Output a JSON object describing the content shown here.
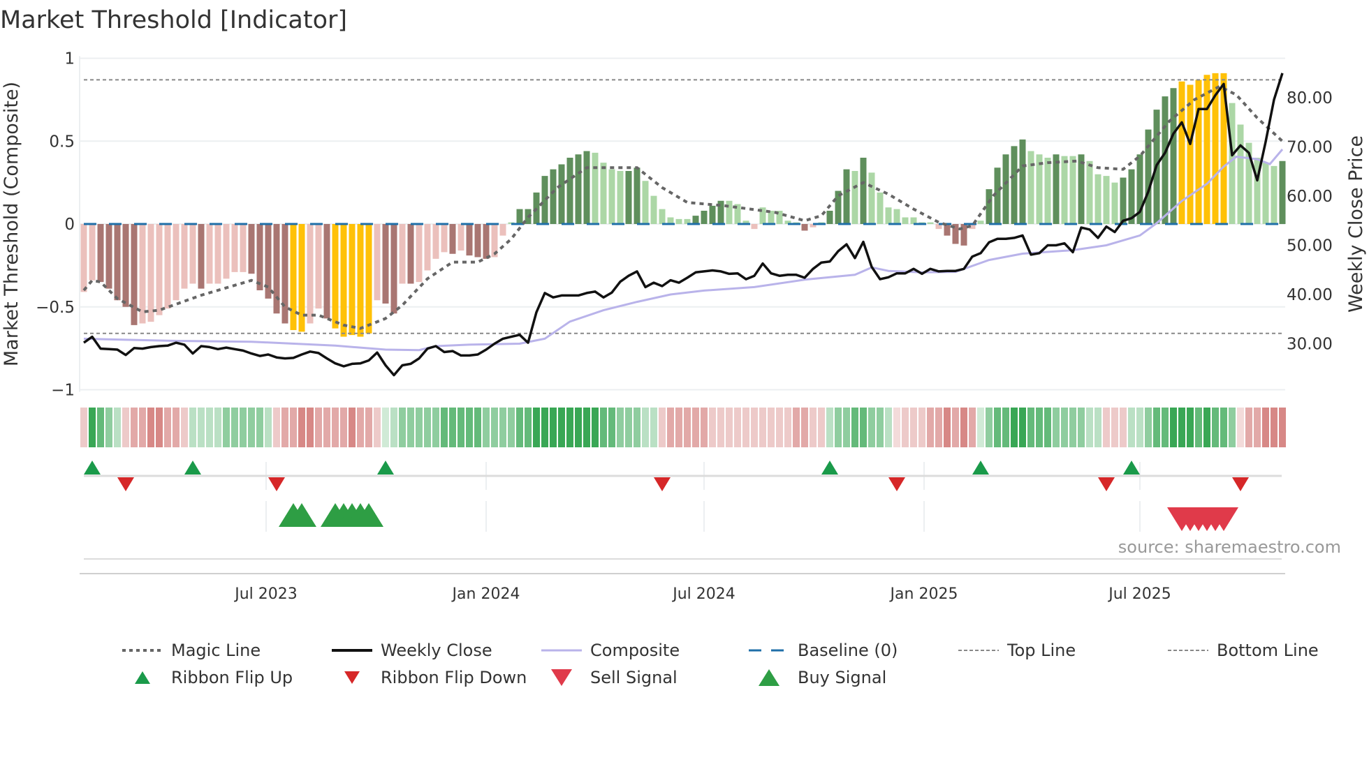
{
  "chart_data": {
    "type": "bar",
    "title": "Market Threshold [Indicator]",
    "ylabel": "Market Threshold (Composite)",
    "y2label": "Weekly Close Price",
    "source": "source: sharemaestro.com",
    "ylim": [
      -1,
      1
    ],
    "y2lim": [
      22,
      93
    ],
    "yticks": [
      {
        "v": 1,
        "label": "1"
      },
      {
        "v": 0.5,
        "label": "0.5"
      },
      {
        "v": 0,
        "label": "0"
      },
      {
        "v": -0.5,
        "label": "−0.5"
      },
      {
        "v": -1,
        "label": "−1"
      }
    ],
    "y2ticks": [
      {
        "v": 80,
        "label": "80.00"
      },
      {
        "v": 70,
        "label": "70.00"
      },
      {
        "v": 60,
        "label": "60.00"
      },
      {
        "v": 50,
        "label": "50.00"
      },
      {
        "v": 40,
        "label": "40.00"
      },
      {
        "v": 30,
        "label": "30.00"
      }
    ],
    "xticks": [
      {
        "week": 21.75,
        "label": "Jul 2023"
      },
      {
        "week": 48,
        "label": "Jan 2024"
      },
      {
        "week": 74,
        "label": "Jul 2024"
      },
      {
        "week": 100.25,
        "label": "Jan 2025"
      },
      {
        "week": 126,
        "label": "Jul 2025"
      }
    ],
    "weeks": 144,
    "top_line": 0.87,
    "bottom_line": -0.66,
    "baseline": 0,
    "composite_bars": [
      -0.41,
      -0.34,
      -0.35,
      -0.39,
      -0.46,
      -0.5,
      -0.61,
      -0.6,
      -0.59,
      -0.55,
      -0.51,
      -0.46,
      -0.39,
      -0.36,
      -0.39,
      -0.36,
      -0.36,
      -0.33,
      -0.29,
      -0.29,
      -0.3,
      -0.4,
      -0.45,
      -0.54,
      -0.6,
      -0.64,
      -0.65,
      -0.6,
      -0.51,
      -0.57,
      -0.63,
      -0.68,
      -0.67,
      -0.68,
      -0.66,
      -0.46,
      -0.48,
      -0.54,
      -0.36,
      -0.36,
      -0.35,
      -0.28,
      -0.21,
      -0.17,
      -0.18,
      -0.16,
      -0.19,
      -0.2,
      -0.21,
      -0.2,
      -0.07,
      0.01,
      0.09,
      0.09,
      0.19,
      0.29,
      0.33,
      0.36,
      0.4,
      0.42,
      0.44,
      0.43,
      0.37,
      0.33,
      0.32,
      0.32,
      0.34,
      0.26,
      0.17,
      0.09,
      0.04,
      0.03,
      0.03,
      0.05,
      0.08,
      0.11,
      0.14,
      0.14,
      0.12,
      0.02,
      -0.03,
      0.1,
      0.08,
      0.08,
      0.02,
      0.01,
      -0.04,
      -0.02,
      0.01,
      0.08,
      0.2,
      0.33,
      0.32,
      0.4,
      0.31,
      0.19,
      0.1,
      0.09,
      0.04,
      0.04,
      0.01,
      0.01,
      -0.03,
      -0.07,
      -0.12,
      -0.13,
      -0.03,
      0.02,
      0.21,
      0.34,
      0.42,
      0.47,
      0.51,
      0.44,
      0.42,
      0.4,
      0.42,
      0.41,
      0.41,
      0.42,
      0.38,
      0.3,
      0.29,
      0.25,
      0.28,
      0.33,
      0.42,
      0.57,
      0.69,
      0.77,
      0.82,
      0.86,
      0.84,
      0.87,
      0.9,
      0.91,
      0.91,
      0.73,
      0.6,
      0.49,
      0.4,
      0.37,
      0.35,
      0.38
    ],
    "bar_states": "lnlndndndndndnlnlnlnlnlnlnlndnlnlnlnlnlndndndndndnyyyylnlndnyyyyyyyylnlndndnlndnlnlnlnlndnlndndndnlnlnlnlpdpdpdpdpdpdpdpdpdpdplplplplpdpdplplplplplp",
    "bar_state_list": [
      "ln",
      "ln",
      "dn",
      "dn",
      "dn",
      "dn",
      "dn",
      "ln",
      "ln",
      "ln",
      "ln",
      "ln",
      "ln",
      "ln",
      "dn",
      "ln",
      "ln",
      "ln",
      "ln",
      "ln",
      "dn",
      "dn",
      "dn",
      "dn",
      "dn",
      "y",
      "y",
      "ln",
      "ln",
      "dn",
      "y",
      "y",
      "y",
      "y",
      "y",
      "ln",
      "dn",
      "dn",
      "ln",
      "dn",
      "ln",
      "ln",
      "ln",
      "ln",
      "dn",
      "ln",
      "dn",
      "dn",
      "dn",
      "ln",
      "ln",
      "lp",
      "dp",
      "dp",
      "dp",
      "dp",
      "dp",
      "dp",
      "dp",
      "dp",
      "dp",
      "lp",
      "lp",
      "lp",
      "lp",
      "dp",
      "dp",
      "lp",
      "lp",
      "lp",
      "lp",
      "lp",
      "lp",
      "dp",
      "dp",
      "dp",
      "dp",
      "lp",
      "lp",
      "lp",
      "ln",
      "lp",
      "lp",
      "lp",
      "lp",
      "lp",
      "dn",
      "ln",
      "lp",
      "dp",
      "dp",
      "dp",
      "lp",
      "dp",
      "lp",
      "lp",
      "lp",
      "lp",
      "lp",
      "lp",
      "lp",
      "lp",
      "ln",
      "dn",
      "dn",
      "dn",
      "ln",
      "lp",
      "dp",
      "dp",
      "dp",
      "dp",
      "dp",
      "lp",
      "lp",
      "lp",
      "dp",
      "lp",
      "lp",
      "dp",
      "lp",
      "lp",
      "lp",
      "lp",
      "dp",
      "dp",
      "dp",
      "dp",
      "dp",
      "dp",
      "dp",
      "y",
      "y",
      "y",
      "y",
      "y",
      "y",
      "lp",
      "lp",
      "lp",
      "lp",
      "lp",
      "lp",
      "dp"
    ],
    "weekly_close": [
      30.2,
      31.4,
      29.0,
      28.9,
      28.8,
      27.7,
      29.1,
      29.0,
      29.3,
      29.5,
      29.6,
      30.2,
      29.8,
      28.0,
      29.5,
      29.3,
      28.9,
      29.2,
      28.9,
      28.6,
      28.0,
      27.5,
      27.8,
      27.2,
      27.0,
      27.1,
      27.8,
      28.4,
      28.1,
      27.0,
      26.0,
      25.4,
      25.9,
      26.0,
      26.6,
      28.2,
      25.6,
      23.6,
      25.6,
      25.9,
      27.0,
      29.0,
      29.5,
      28.3,
      28.5,
      27.6,
      27.6,
      27.8,
      28.8,
      30.0,
      31.0,
      31.4,
      31.8,
      30.2,
      36.4,
      40.3,
      39.4,
      39.8,
      39.8,
      39.8,
      40.3,
      40.6,
      39.4,
      40.4,
      42.6,
      43.8,
      44.7,
      41.5,
      42.4,
      41.7,
      42.9,
      42.4,
      43.4,
      44.5,
      44.7,
      44.9,
      44.7,
      44.2,
      44.3,
      43.1,
      43.8,
      46.3,
      44.3,
      43.8,
      44.0,
      44.0,
      43.4,
      45.2,
      46.5,
      46.7,
      48.8,
      50.2,
      47.4,
      50.7,
      45.6,
      43.1,
      43.5,
      44.3,
      44.3,
      45.2,
      44.2,
      45.2,
      44.7,
      44.8,
      44.8,
      45.2,
      47.7,
      48.4,
      50.6,
      51.3,
      51.3,
      51.5,
      52.0,
      48.1,
      48.4,
      50.0,
      50.0,
      50.4,
      48.6,
      53.6,
      53.2,
      51.5,
      53.8,
      52.7,
      55.0,
      55.5,
      56.8,
      60.9,
      66.3,
      68.8,
      72.7,
      75.0,
      70.6,
      77.7,
      77.7,
      80.5,
      82.8,
      68.3,
      70.3,
      68.8,
      63.2,
      71.0,
      79.6,
      85.0
    ],
    "composite_line": [
      [
        0,
        31.0
      ],
      [
        10,
        30.6
      ],
      [
        20,
        30.4
      ],
      [
        30,
        29.6
      ],
      [
        36,
        28.8
      ],
      [
        40,
        28.7
      ],
      [
        42,
        29.5
      ],
      [
        46,
        29.8
      ],
      [
        52,
        30.0
      ],
      [
        55,
        31.0
      ],
      [
        58,
        34.5
      ],
      [
        62,
        36.8
      ],
      [
        66,
        38.5
      ],
      [
        70,
        40.0
      ],
      [
        74,
        40.8
      ],
      [
        80,
        41.5
      ],
      [
        86,
        43.0
      ],
      [
        92,
        44.0
      ],
      [
        94,
        45.5
      ],
      [
        96,
        44.8
      ],
      [
        100,
        44.5
      ],
      [
        104,
        44.6
      ],
      [
        108,
        47.0
      ],
      [
        112,
        48.3
      ],
      [
        118,
        49.0
      ],
      [
        122,
        50.0
      ],
      [
        126,
        52.0
      ],
      [
        128,
        54.5
      ],
      [
        131,
        59.0
      ],
      [
        134,
        62.5
      ],
      [
        136,
        66.0
      ],
      [
        137.5,
        68.0
      ],
      [
        140,
        67.5
      ],
      [
        141.5,
        66.5
      ],
      [
        143,
        69.5
      ]
    ],
    "magic_line": [
      [
        0,
        -0.4
      ],
      [
        1,
        -0.34
      ],
      [
        2,
        -0.35
      ],
      [
        4,
        -0.45
      ],
      [
        7,
        -0.53
      ],
      [
        9,
        -0.52
      ],
      [
        14,
        -0.43
      ],
      [
        20,
        -0.34
      ],
      [
        22,
        -0.38
      ],
      [
        24,
        -0.5
      ],
      [
        26,
        -0.55
      ],
      [
        28,
        -0.55
      ],
      [
        31,
        -0.61
      ],
      [
        33,
        -0.63
      ],
      [
        36,
        -0.57
      ],
      [
        38,
        -0.49
      ],
      [
        41,
        -0.33
      ],
      [
        44,
        -0.23
      ],
      [
        47,
        -0.23
      ],
      [
        49,
        -0.18
      ],
      [
        51,
        -0.09
      ],
      [
        53,
        0.04
      ],
      [
        56.5,
        0.22
      ],
      [
        60,
        0.34
      ],
      [
        63,
        0.34
      ],
      [
        66,
        0.34
      ],
      [
        69,
        0.22
      ],
      [
        72,
        0.13
      ],
      [
        76.5,
        0.11
      ],
      [
        79.5,
        0.09
      ],
      [
        82.5,
        0.07
      ],
      [
        86,
        0.02
      ],
      [
        88,
        0.05
      ],
      [
        90,
        0.17
      ],
      [
        93,
        0.25
      ],
      [
        96,
        0.18
      ],
      [
        99,
        0.09
      ],
      [
        102,
        0.01
      ],
      [
        104.5,
        -0.03
      ],
      [
        106,
        -0.01
      ],
      [
        108.5,
        0.17
      ],
      [
        112,
        0.35
      ],
      [
        115,
        0.37
      ],
      [
        118.5,
        0.38
      ],
      [
        121,
        0.34
      ],
      [
        124,
        0.33
      ],
      [
        126,
        0.41
      ],
      [
        129.5,
        0.62
      ],
      [
        132.5,
        0.75
      ],
      [
        135.5,
        0.83
      ],
      [
        137.5,
        0.78
      ],
      [
        140,
        0.64
      ],
      [
        143,
        0.5
      ]
    ],
    "ribbon": [
      -1,
      4,
      3,
      2,
      1,
      -1,
      -2,
      -2,
      -3,
      -3,
      -2,
      -2,
      -1,
      1,
      1,
      1,
      1,
      2,
      2,
      2,
      2,
      2,
      1,
      -1,
      -2,
      -2,
      -3,
      -3,
      -2,
      -2,
      -2,
      -2,
      -3,
      -2,
      -2,
      -1,
      0.5,
      1,
      2,
      2,
      2,
      2,
      2,
      3,
      3,
      3,
      3,
      3,
      2,
      2,
      2,
      2,
      3,
      3,
      4,
      4,
      4,
      4,
      4,
      4,
      4,
      4,
      3,
      3,
      2,
      2,
      2,
      1,
      1,
      -1,
      -2,
      -2,
      -2,
      -2,
      -2,
      -1,
      -1,
      -1,
      -1,
      -1,
      -1,
      -1,
      -1,
      -1,
      -1,
      -2,
      -2,
      -1,
      -1,
      1,
      2,
      2,
      3,
      3,
      2,
      2,
      1,
      -0.5,
      -1,
      -1,
      -1,
      -2,
      -2,
      -3,
      -2,
      -3,
      -2,
      0.5,
      2,
      3,
      3,
      4,
      4,
      3,
      3,
      3,
      2,
      2,
      2,
      2,
      1,
      1,
      -1,
      -1,
      -1,
      1,
      1,
      2,
      3,
      3,
      4,
      4,
      4,
      3,
      4,
      3,
      3,
      2,
      -0.5,
      -2,
      -2,
      -3,
      -3,
      -3
    ],
    "ribbon_flip_up": [
      1,
      13,
      36,
      89,
      107,
      125
    ],
    "ribbon_flip_down": [
      5,
      23,
      69,
      97,
      122,
      138
    ],
    "buy_signal": [
      25,
      26,
      30,
      31,
      32,
      33,
      34
    ],
    "sell_signal": [
      131,
      132,
      133,
      134,
      135,
      136
    ],
    "legend": [
      {
        "label": "Magic Line",
        "kind": "dotted",
        "color": "#666666"
      },
      {
        "label": "Weekly Close",
        "kind": "line",
        "color": "#111111"
      },
      {
        "label": "Composite",
        "kind": "line",
        "color": "#b9b3ea"
      },
      {
        "label": "Baseline (0)",
        "kind": "dashed",
        "color": "#1f6fa8"
      },
      {
        "label": "Top Line",
        "kind": "fine-dashed",
        "color": "#888888"
      },
      {
        "label": "Bottom Line",
        "kind": "fine-dashed",
        "color": "#888888"
      },
      {
        "label": "Ribbon Flip Up",
        "kind": "tri-up-small",
        "color": "#1a9a4a"
      },
      {
        "label": "Ribbon Flip Down",
        "kind": "tri-down-small",
        "color": "#d62728"
      },
      {
        "label": "Sell Signal",
        "kind": "tri-down",
        "color": "#e03a4a"
      },
      {
        "label": "Buy Signal",
        "kind": "tri-up",
        "color": "#2e9e44"
      }
    ],
    "colors": {
      "dn": "#a97672",
      "ln": "#ebc0bc",
      "dp": "#5f8f5c",
      "lp": "#acd7a6",
      "y": "#ffc107",
      "close": "#111111",
      "composite": "#b9b3ea",
      "magic": "#666666",
      "baseline": "#1f6fa8",
      "guide": "#888888"
    }
  }
}
